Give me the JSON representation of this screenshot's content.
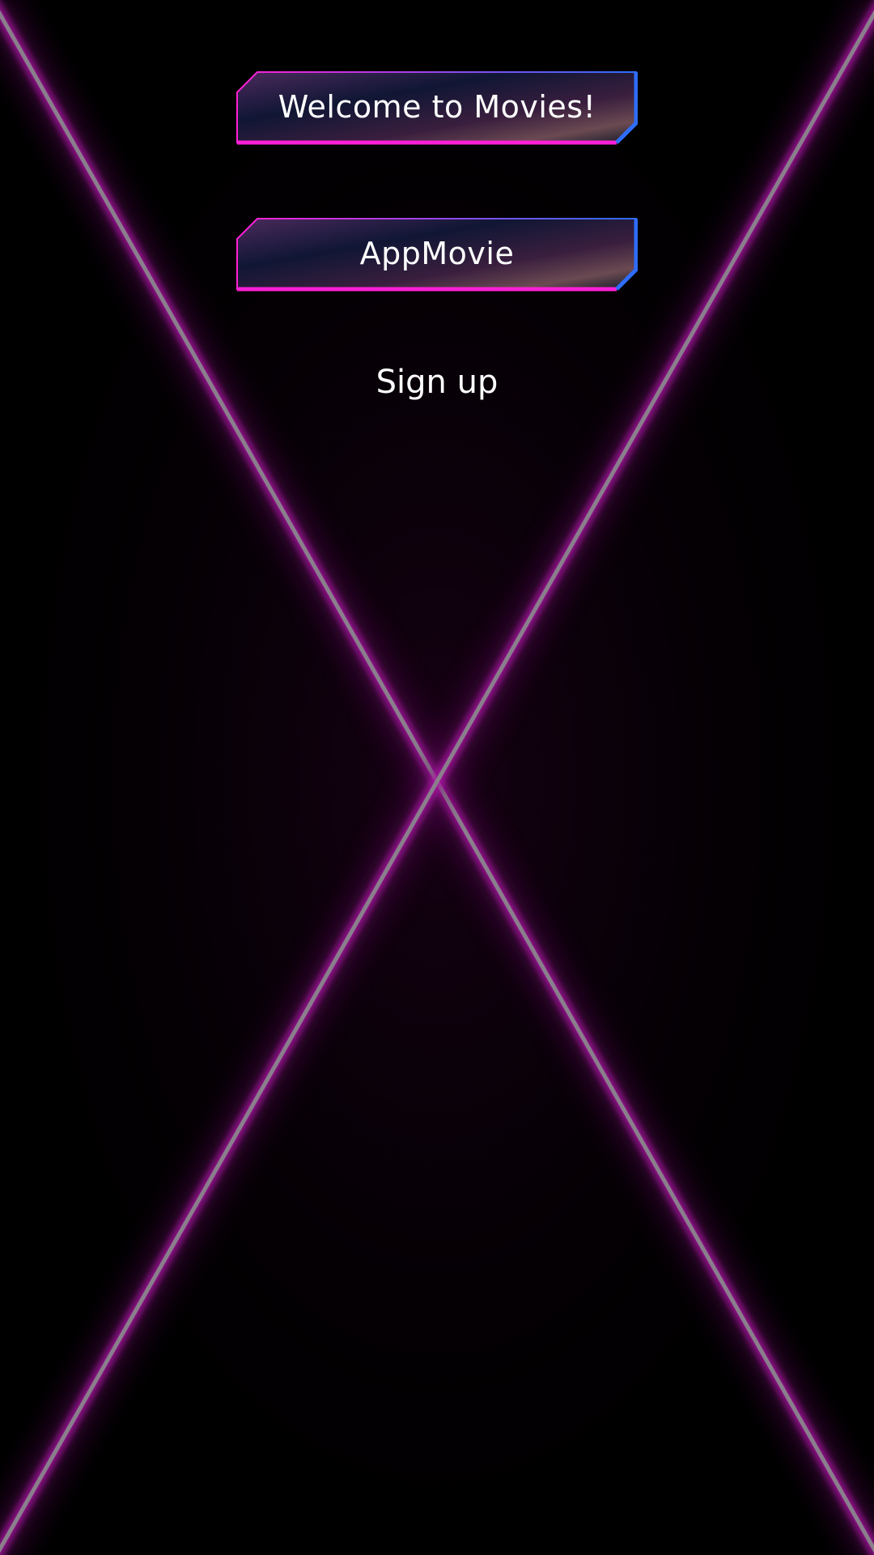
{
  "welcome_banner": {
    "label": "Welcome to Movies!"
  },
  "app_banner": {
    "label": "AppMovie"
  },
  "signup": {
    "label": "Sign up"
  },
  "colors": {
    "background": "#000000",
    "neon_magenta": "#ff1fd6",
    "neon_blue": "#2f6dff",
    "line_core": "#8a7f8c",
    "line_glow": "#a0149a",
    "text": "#ffffff"
  }
}
